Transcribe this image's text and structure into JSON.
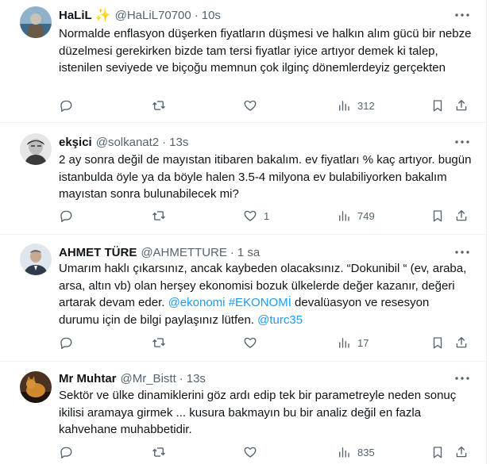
{
  "tweets": [
    {
      "name": "HaLiL",
      "sparkle": "✨",
      "handle": "@HaLiL70700",
      "time": "10s",
      "text": "Normalde enflasyon düşerken fiyatların düşmesi ve halkın alım gücü bir nebze düzelmesi gerekirken bizde tam tersi fiyatlar iyice artıyor demek ki talep, istenilen seviyede ve biçoğu memnun çok ilginç dönemlerdeyiz gerçekten",
      "likes": "",
      "views": "312",
      "avatar_colors": [
        "#6a8fb0",
        "#c9c2b4",
        "#3d6a8a"
      ]
    },
    {
      "name": "ekşici",
      "handle": "@solkanat2",
      "time": "13s",
      "text": "2 ay sonra değil de mayıstan itibaren bakalım. ev fiyatları % kaç artıyor. bugün istanbulda öyle ya da böyle halen 3.5-4 milyona ev bulabiliyorken bakalım mayıstan sonra bulunabilecek mi?",
      "likes": "1",
      "views": "749",
      "avatar_colors": [
        "#3a3a3a",
        "#bdbdbd",
        "#777777"
      ]
    },
    {
      "name": "AHMET TÜRE",
      "handle": "@AHMETTURE",
      "time": "1 sa",
      "text_parts": {
        "plain": "Umarım haklı çıkarsınız, ancak kaybeden olacaksınız. “Dokunibil “ (ev, araba, arsa, altın vb) olan herşey ekonomisi bozuk ülkelerde değer kazanır, değeri artarak devam eder. ",
        "mention1": "@ekonomi",
        "mention2": "#EKONOMİ",
        "plain2": " devalüasyon ve resesyon durumu için de bilgi paylaşınız lütfen. ",
        "mention3": "@turc35"
      },
      "likes": "",
      "views": "17",
      "avatar_colors": [
        "#dfe6ee",
        "#2f3b4a",
        "#c8a994"
      ]
    },
    {
      "name": "Mr Muhtar",
      "handle": "@Mr_Bistt",
      "time": "13s",
      "text": "Sektör ve ülke dinamiklerini göz ardı edip tek bir parametreyle neden sonuç ikilisi aramaya girmek ... kusura bakmayın bu bir analiz değil en fazla kahvehane muhabbetidir.",
      "likes": "",
      "views": "835",
      "avatar_colors": [
        "#4a3320",
        "#d0882e",
        "#1e140c"
      ]
    }
  ],
  "icons": [
    "more-icon",
    "reply-icon",
    "retweet-icon",
    "like-icon",
    "views-icon",
    "bookmark-icon",
    "share-icon"
  ]
}
